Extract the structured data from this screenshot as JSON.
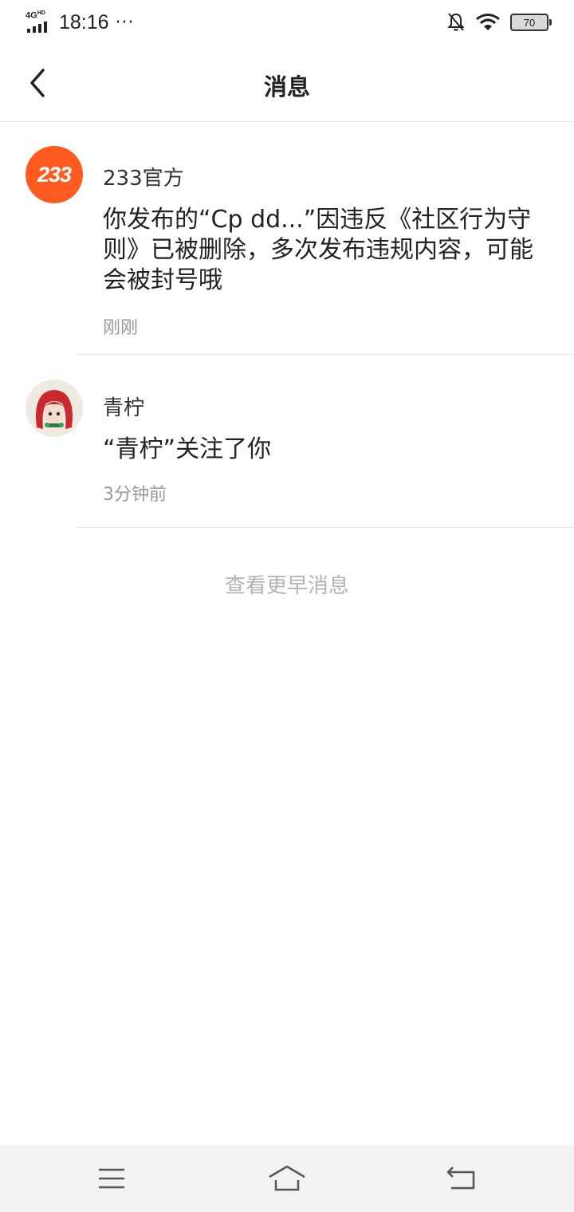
{
  "status_bar": {
    "network": "4G",
    "network_sup": "HD",
    "time": "18:16",
    "more": "···",
    "battery": "70"
  },
  "header": {
    "title": "消息"
  },
  "messages": [
    {
      "sender": "233官方",
      "avatar_text": "233",
      "content": "你发布的“Cp dd...”因违反《社区行为守则》已被删除，多次发布违规内容，可能会被封号哦",
      "time": "刚刚"
    },
    {
      "sender": "青柠",
      "content": "“青柠”关注了你",
      "time": "3分钟前"
    }
  ],
  "load_earlier": "查看更早消息",
  "colors": {
    "brand_orange": "#ff5a1f",
    "time_gray": "#999999",
    "divider": "#e6e6e6"
  },
  "icons": {
    "back": "chevron-left-icon",
    "menu": "menu-icon",
    "home": "home-icon",
    "return": "return-icon",
    "bell_muted": "bell-off-icon",
    "wifi": "wifi-icon"
  }
}
